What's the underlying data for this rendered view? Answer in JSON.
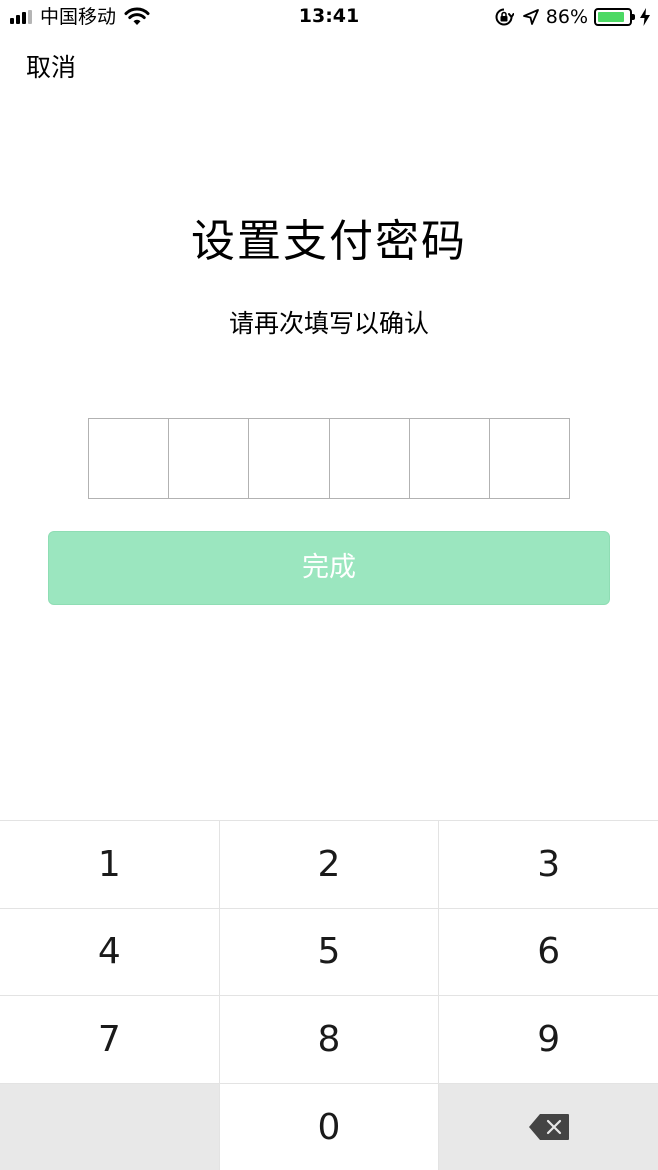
{
  "status_bar": {
    "carrier": "中国移动",
    "time": "13:41",
    "battery_percent": "86%",
    "battery_level": 0.86,
    "icons": [
      "signal-icon",
      "wifi-icon",
      "orientation-lock-icon",
      "location-arrow-icon",
      "battery-icon",
      "charging-bolt-icon"
    ]
  },
  "nav": {
    "cancel_label": "取消"
  },
  "main": {
    "title": "设置支付密码",
    "subtitle": "请再次填写以确认",
    "pin_length": 6,
    "done_label": "完成",
    "done_color": "#9be6bf"
  },
  "keypad": {
    "keys": [
      "1",
      "2",
      "3",
      "4",
      "5",
      "6",
      "7",
      "8",
      "9",
      "",
      "0",
      "delete"
    ]
  }
}
